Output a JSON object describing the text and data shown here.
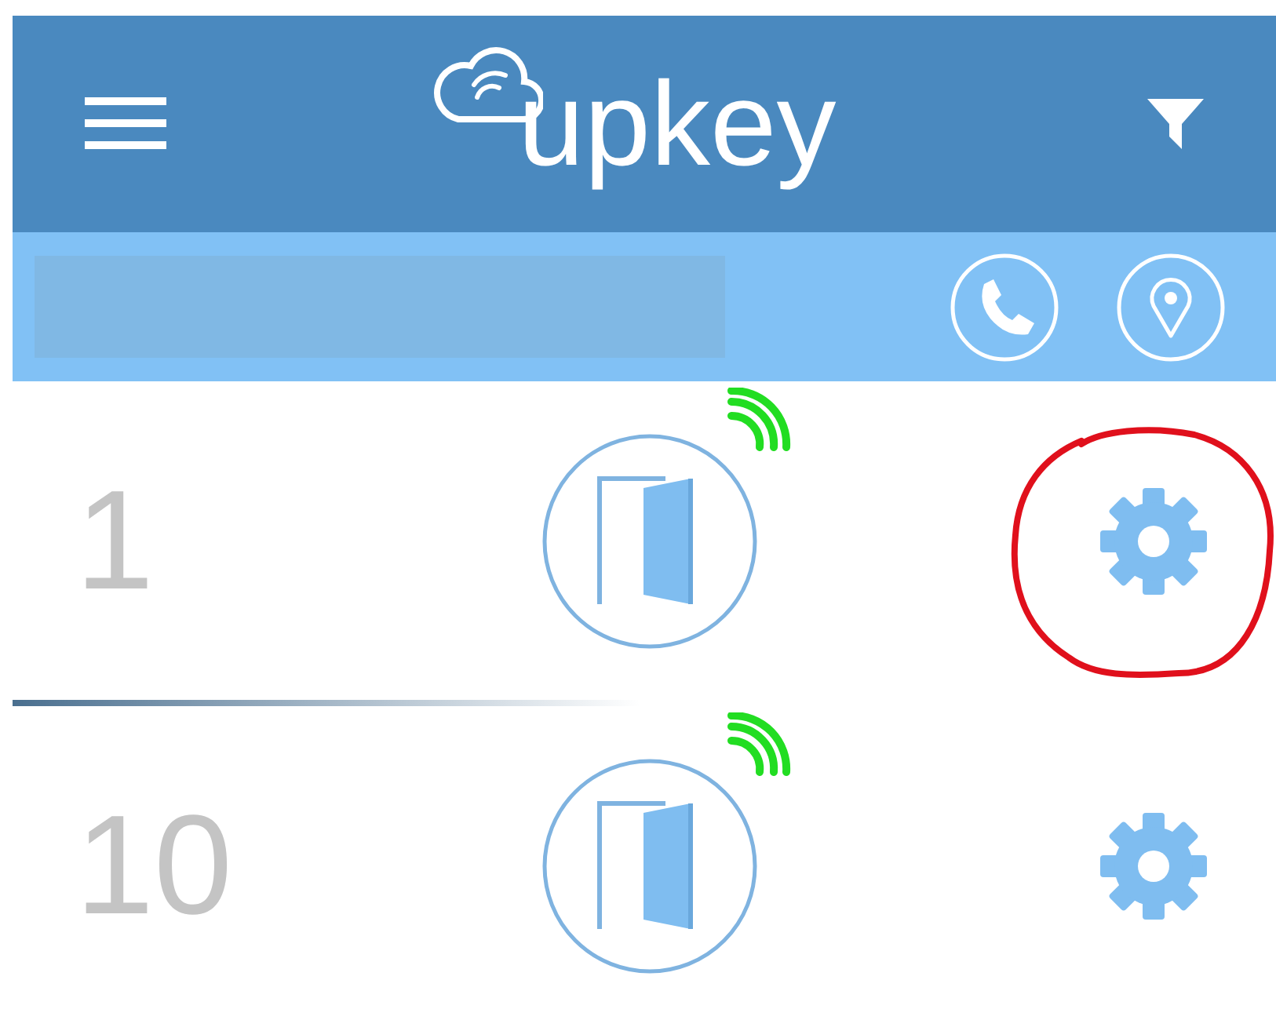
{
  "header": {
    "logo_text": "upkey"
  },
  "rows": [
    {
      "number": "1",
      "connected": true,
      "annotated": true
    },
    {
      "number": "10",
      "connected": true,
      "annotated": false
    }
  ]
}
